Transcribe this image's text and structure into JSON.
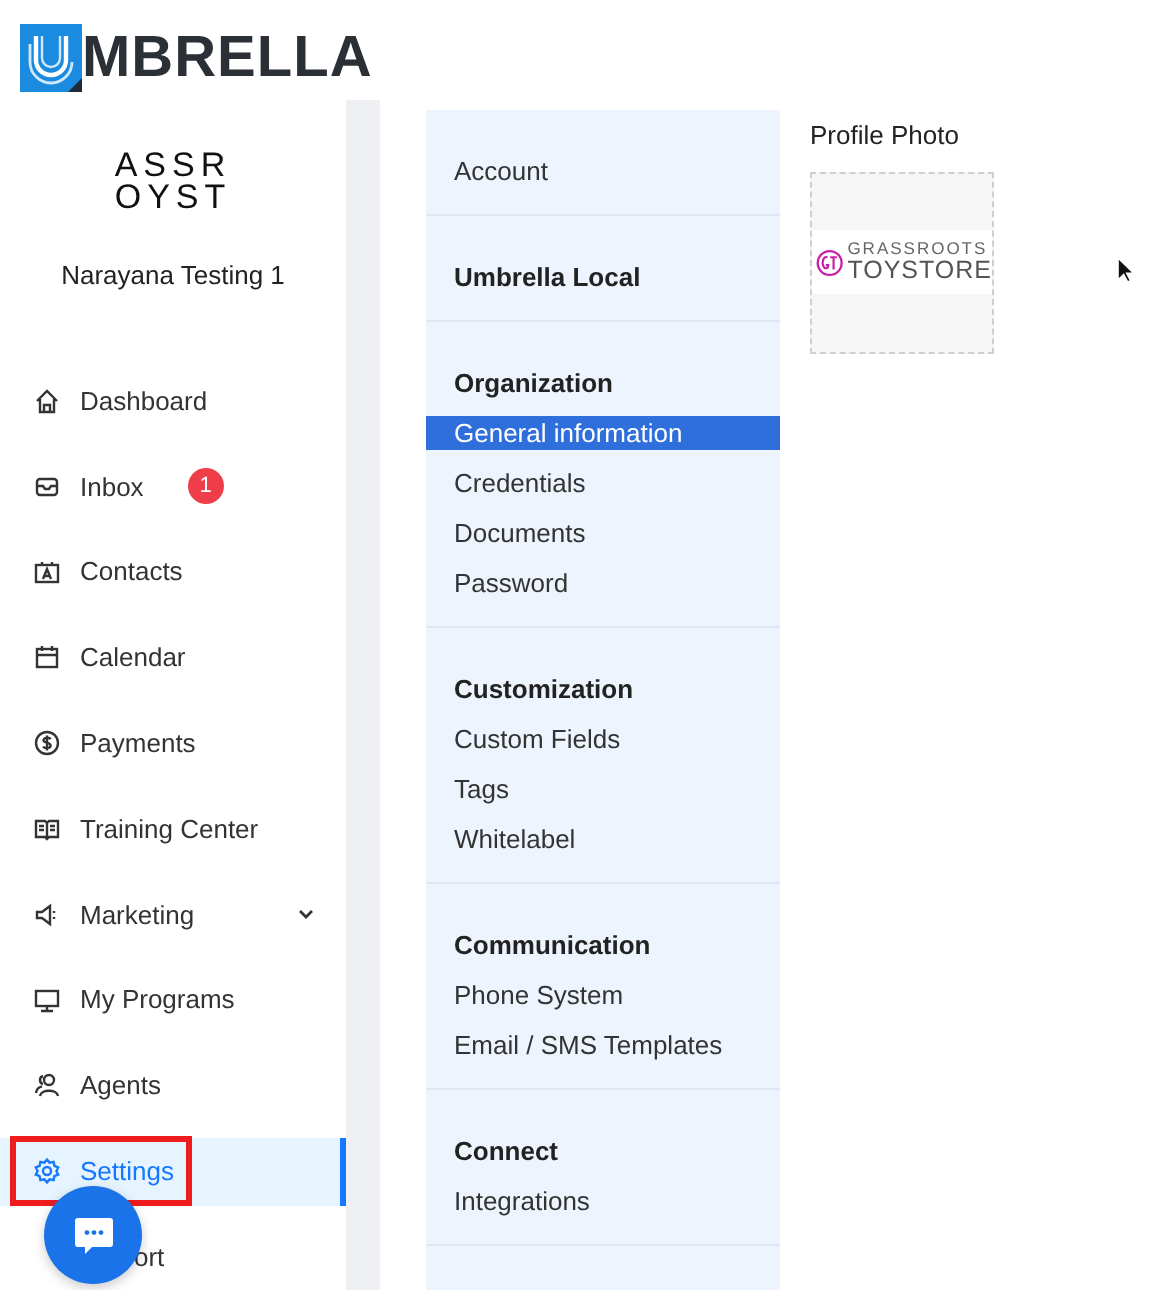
{
  "brand": {
    "name": "MBRELLA"
  },
  "sidebar": {
    "org_logo": [
      "ASSR",
      "OYST"
    ],
    "org_name": "Narayana Testing 1",
    "items": [
      {
        "label": "Dashboard",
        "selected": false,
        "outlined": false
      },
      {
        "label": "Inbox",
        "selected": false,
        "outlined": false,
        "badge": "1"
      },
      {
        "label": "Contacts",
        "selected": false,
        "outlined": false
      },
      {
        "label": "Calendar",
        "selected": false,
        "outlined": false
      },
      {
        "label": "Payments",
        "selected": false,
        "outlined": false
      },
      {
        "label": "Training Center",
        "selected": false,
        "outlined": false
      },
      {
        "label": "Marketing",
        "selected": false,
        "outlined": false,
        "expandable": true
      },
      {
        "label": "My Programs",
        "selected": false,
        "outlined": false
      },
      {
        "label": "Agents",
        "selected": false,
        "outlined": false
      },
      {
        "label": "Settings",
        "selected": true,
        "outlined": true
      },
      {
        "label": "ort",
        "selected": false,
        "outlined": false,
        "covered": true
      }
    ]
  },
  "settings_menu": [
    {
      "label": "Account",
      "kind": "link"
    },
    {
      "label": "Umbrella Local",
      "kind": "heading"
    },
    {
      "label": "Organization",
      "kind": "heading",
      "items": [
        {
          "label": "General information",
          "selected": true
        },
        {
          "label": "Credentials",
          "selected": false
        },
        {
          "label": "Documents",
          "selected": false
        },
        {
          "label": "Password",
          "selected": false
        }
      ]
    },
    {
      "label": "Customization",
      "kind": "heading",
      "items": [
        {
          "label": "Custom Fields",
          "selected": false
        },
        {
          "label": "Tags",
          "selected": false
        },
        {
          "label": "Whitelabel",
          "selected": false
        }
      ]
    },
    {
      "label": "Communication",
      "kind": "heading",
      "items": [
        {
          "label": "Phone System",
          "selected": false
        },
        {
          "label": "Email / SMS Templates",
          "selected": false
        }
      ]
    },
    {
      "label": "Connect",
      "kind": "heading",
      "items": [
        {
          "label": "Integrations",
          "selected": false
        }
      ]
    }
  ],
  "profile_photo": {
    "label": "Profile Photo",
    "logo_lines": [
      "GRASSROOTS",
      "TOYSTORE"
    ]
  }
}
